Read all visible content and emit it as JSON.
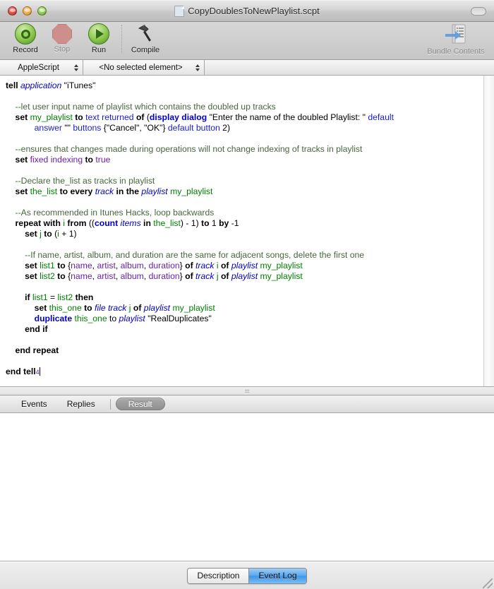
{
  "window": {
    "title": "CopyDoublesToNewPlaylist.scpt",
    "traffic": {
      "close": "close",
      "minimize": "minimize",
      "zoom": "zoom"
    }
  },
  "toolbar": {
    "items": [
      {
        "label": "Record",
        "icon": "record-icon",
        "disabled": false
      },
      {
        "label": "Stop",
        "icon": "stop-icon",
        "disabled": true
      },
      {
        "label": "Run",
        "icon": "run-icon",
        "disabled": false
      },
      {
        "label": "Compile",
        "icon": "hammer-icon",
        "disabled": false
      }
    ],
    "bundle": {
      "label": "Bundle Contents",
      "icon": "bundle-contents-icon",
      "disabled": true
    }
  },
  "navbar": {
    "language": "AppleScript",
    "element": "<No selected element>"
  },
  "code": {
    "lines": [
      [
        {
          "t": "tell ",
          "c": "kw"
        },
        {
          "t": "application",
          "c": "ref"
        },
        {
          "t": " ",
          "c": "str"
        },
        {
          "t": "\"iTunes\"",
          "c": "str"
        }
      ],
      [],
      [
        {
          "t": "    --let user input name of playlist which contains the doubled up tracks",
          "c": "cmt"
        }
      ],
      [
        {
          "t": "    ",
          "c": "str"
        },
        {
          "t": "set ",
          "c": "kw"
        },
        {
          "t": "my_playlist",
          "c": "var"
        },
        {
          "t": " to ",
          "c": "kw"
        },
        {
          "t": "text returned",
          "c": "prop"
        },
        {
          "t": " of ",
          "c": "kw"
        },
        {
          "t": "(",
          "c": "str"
        },
        {
          "t": "display dialog",
          "c": "cmd"
        },
        {
          "t": " \"Enter the name of the doubled Playlist: \" ",
          "c": "str"
        },
        {
          "t": "default",
          "c": "prop"
        }
      ],
      [
        {
          "t": "            ",
          "c": "str"
        },
        {
          "t": "answer",
          "c": "prop"
        },
        {
          "t": " \"\" ",
          "c": "str"
        },
        {
          "t": "buttons",
          "c": "prop"
        },
        {
          "t": " {\"Cancel\", \"OK\"} ",
          "c": "str"
        },
        {
          "t": "default button",
          "c": "prop"
        },
        {
          "t": " 2)",
          "c": "num"
        }
      ],
      [],
      [
        {
          "t": "    --ensures that changes made during operations will not change indexing of tracks in playlist",
          "c": "cmt"
        }
      ],
      [
        {
          "t": "    ",
          "c": "str"
        },
        {
          "t": "set ",
          "c": "kw"
        },
        {
          "t": "fixed indexing",
          "c": "cls"
        },
        {
          "t": " to ",
          "c": "kw"
        },
        {
          "t": "true",
          "c": "cls"
        }
      ],
      [],
      [
        {
          "t": "    --Declare the_list as tracks in playlist",
          "c": "cmt"
        }
      ],
      [
        {
          "t": "    ",
          "c": "str"
        },
        {
          "t": "set ",
          "c": "kw"
        },
        {
          "t": "the_list",
          "c": "var"
        },
        {
          "t": " to every ",
          "c": "kw"
        },
        {
          "t": "track",
          "c": "ref"
        },
        {
          "t": " in the ",
          "c": "kw"
        },
        {
          "t": "playlist",
          "c": "ref"
        },
        {
          "t": " ",
          "c": "str"
        },
        {
          "t": "my_playlist",
          "c": "var"
        }
      ],
      [],
      [
        {
          "t": "    --As recommended in Itunes Hacks, loop backwards",
          "c": "cmt"
        }
      ],
      [
        {
          "t": "    ",
          "c": "str"
        },
        {
          "t": "repeat with ",
          "c": "kw"
        },
        {
          "t": "i",
          "c": "var"
        },
        {
          "t": " from ",
          "c": "kw"
        },
        {
          "t": "((",
          "c": "str"
        },
        {
          "t": "count",
          "c": "cmd"
        },
        {
          "t": " ",
          "c": "str"
        },
        {
          "t": "items",
          "c": "ref"
        },
        {
          "t": " in ",
          "c": "kw"
        },
        {
          "t": "the_list",
          "c": "var"
        },
        {
          "t": ") - 1) ",
          "c": "str"
        },
        {
          "t": "to ",
          "c": "kw"
        },
        {
          "t": "1 ",
          "c": "num"
        },
        {
          "t": "by ",
          "c": "kw"
        },
        {
          "t": "-1",
          "c": "num"
        }
      ],
      [
        {
          "t": "        ",
          "c": "str"
        },
        {
          "t": "set ",
          "c": "kw"
        },
        {
          "t": "j",
          "c": "var"
        },
        {
          "t": " to ",
          "c": "kw"
        },
        {
          "t": "(",
          "c": "str"
        },
        {
          "t": "i",
          "c": "var"
        },
        {
          "t": " + 1)",
          "c": "str"
        }
      ],
      [],
      [
        {
          "t": "        --If name, artist, album, and duration are the same for adjacent songs, delete the first one",
          "c": "cmt"
        }
      ],
      [
        {
          "t": "        ",
          "c": "str"
        },
        {
          "t": "set ",
          "c": "kw"
        },
        {
          "t": "list1",
          "c": "var"
        },
        {
          "t": " to ",
          "c": "kw"
        },
        {
          "t": "{",
          "c": "str"
        },
        {
          "t": "name",
          "c": "cls"
        },
        {
          "t": ", ",
          "c": "str"
        },
        {
          "t": "artist",
          "c": "cls"
        },
        {
          "t": ", ",
          "c": "str"
        },
        {
          "t": "album",
          "c": "cls"
        },
        {
          "t": ", ",
          "c": "str"
        },
        {
          "t": "duration",
          "c": "cls"
        },
        {
          "t": "} ",
          "c": "str"
        },
        {
          "t": "of ",
          "c": "kw"
        },
        {
          "t": "track",
          "c": "ref"
        },
        {
          "t": " ",
          "c": "str"
        },
        {
          "t": "i",
          "c": "var"
        },
        {
          "t": " of ",
          "c": "kw"
        },
        {
          "t": "playlist",
          "c": "ref"
        },
        {
          "t": " ",
          "c": "str"
        },
        {
          "t": "my_playlist",
          "c": "var"
        }
      ],
      [
        {
          "t": "        ",
          "c": "str"
        },
        {
          "t": "set ",
          "c": "kw"
        },
        {
          "t": "list2",
          "c": "var"
        },
        {
          "t": " to ",
          "c": "kw"
        },
        {
          "t": "{",
          "c": "str"
        },
        {
          "t": "name",
          "c": "cls"
        },
        {
          "t": ", ",
          "c": "str"
        },
        {
          "t": "artist",
          "c": "cls"
        },
        {
          "t": ", ",
          "c": "str"
        },
        {
          "t": "album",
          "c": "cls"
        },
        {
          "t": ", ",
          "c": "str"
        },
        {
          "t": "duration",
          "c": "cls"
        },
        {
          "t": "} ",
          "c": "str"
        },
        {
          "t": "of ",
          "c": "kw"
        },
        {
          "t": "track",
          "c": "ref"
        },
        {
          "t": " ",
          "c": "str"
        },
        {
          "t": "j",
          "c": "var"
        },
        {
          "t": " of ",
          "c": "kw"
        },
        {
          "t": "playlist",
          "c": "ref"
        },
        {
          "t": " ",
          "c": "str"
        },
        {
          "t": "my_playlist",
          "c": "var"
        }
      ],
      [],
      [
        {
          "t": "        ",
          "c": "str"
        },
        {
          "t": "if ",
          "c": "kw"
        },
        {
          "t": "list1",
          "c": "var"
        },
        {
          "t": " = ",
          "c": "str"
        },
        {
          "t": "list2",
          "c": "var"
        },
        {
          "t": " then",
          "c": "kw"
        }
      ],
      [
        {
          "t": "            ",
          "c": "str"
        },
        {
          "t": "set ",
          "c": "kw"
        },
        {
          "t": "this_one",
          "c": "var"
        },
        {
          "t": " to ",
          "c": "kw"
        },
        {
          "t": "file track",
          "c": "ref"
        },
        {
          "t": " ",
          "c": "str"
        },
        {
          "t": "j",
          "c": "var"
        },
        {
          "t": " of ",
          "c": "kw"
        },
        {
          "t": "playlist",
          "c": "ref"
        },
        {
          "t": " ",
          "c": "str"
        },
        {
          "t": "my_playlist",
          "c": "var"
        }
      ],
      [
        {
          "t": "            ",
          "c": "str"
        },
        {
          "t": "duplicate",
          "c": "cmd"
        },
        {
          "t": " ",
          "c": "str"
        },
        {
          "t": "this_one",
          "c": "var"
        },
        {
          "t": " to ",
          "c": "str"
        },
        {
          "t": "playlist",
          "c": "ref"
        },
        {
          "t": " \"RealDuplicates\"",
          "c": "str"
        }
      ],
      [
        {
          "t": "        ",
          "c": "str"
        },
        {
          "t": "end if",
          "c": "kw"
        }
      ],
      [],
      [
        {
          "t": "    ",
          "c": "str"
        },
        {
          "t": "end repeat",
          "c": "kw"
        }
      ],
      [],
      [
        {
          "t": "end tell",
          "c": "kw"
        },
        {
          "t": "4",
          "c": "caretnum"
        },
        {
          "t": "",
          "c": "caret"
        }
      ]
    ]
  },
  "log": {
    "tabs": [
      {
        "label": "Events",
        "selected": false
      },
      {
        "label": "Replies",
        "selected": false
      },
      {
        "label": "Result",
        "selected": true
      }
    ],
    "content": ""
  },
  "footer": {
    "segments": [
      {
        "label": "Description",
        "selected": false
      },
      {
        "label": "Event Log",
        "selected": true
      }
    ]
  }
}
